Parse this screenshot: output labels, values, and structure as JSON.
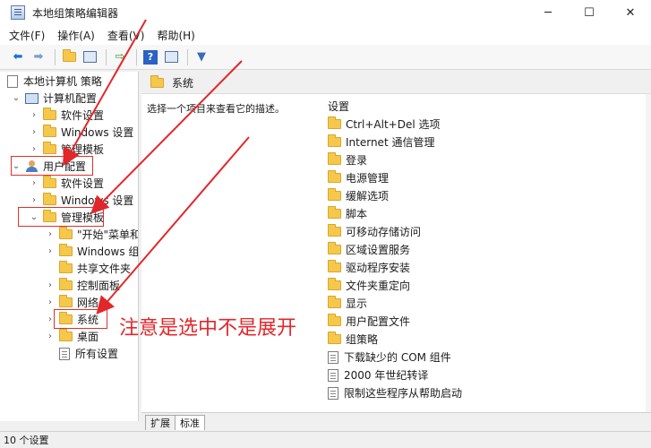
{
  "window": {
    "title": "本地组策略编辑器",
    "minimize_glyph": "─",
    "maximize_glyph": "☐",
    "close_glyph": "✕"
  },
  "menu": [
    "文件(F)",
    "操作(A)",
    "查看(V)",
    "帮助(H)"
  ],
  "toolbar": {
    "buttons": [
      "back-arrow-icon",
      "forward-arrow-icon",
      "up-folder-icon",
      "show-hide-tree-icon",
      "export-list-icon",
      "help-icon",
      "properties-icon",
      "filter-icon"
    ]
  },
  "tree": [
    {
      "label": "本地计算机 策略",
      "icon": "policy-icon",
      "expander": ""
    },
    {
      "label": "计算机配置",
      "icon": "pc-icon",
      "expander": "⌄"
    },
    {
      "label": "软件设置",
      "icon": "folder-icon",
      "expander": "›"
    },
    {
      "label": "Windows 设置",
      "icon": "folder-icon",
      "expander": "›"
    },
    {
      "label": "管理模板",
      "icon": "folder-icon",
      "expander": "›"
    },
    {
      "label": "用户配置",
      "icon": "user-icon",
      "expander": "⌄"
    },
    {
      "label": "软件设置",
      "icon": "folder-icon",
      "expander": "›"
    },
    {
      "label": "Windows 设置",
      "icon": "folder-icon",
      "expander": "›"
    },
    {
      "label": "管理模板",
      "icon": "folder-icon",
      "expander": "⌄"
    },
    {
      "label": "\"开始\"菜单和",
      "icon": "folder-icon",
      "expander": "›"
    },
    {
      "label": "Windows 组",
      "icon": "folder-icon",
      "expander": "›"
    },
    {
      "label": "共享文件夹",
      "icon": "folder-icon",
      "expander": ""
    },
    {
      "label": "控制面板",
      "icon": "folder-icon",
      "expander": "›"
    },
    {
      "label": "网络",
      "icon": "folder-icon",
      "expander": "›"
    },
    {
      "label": "系统",
      "icon": "folder-icon",
      "expander": "›"
    },
    {
      "label": "桌面",
      "icon": "folder-icon",
      "expander": "›"
    },
    {
      "label": "所有设置",
      "icon": "doc-icon",
      "expander": ""
    }
  ],
  "right_pane": {
    "header": "系统",
    "description": "选择一个项目来查看它的描述。",
    "column_header": "设置",
    "items": [
      {
        "label": "Ctrl+Alt+Del 选项",
        "icon": "folder-icon"
      },
      {
        "label": "Internet 通信管理",
        "icon": "folder-icon"
      },
      {
        "label": "登录",
        "icon": "folder-icon"
      },
      {
        "label": "电源管理",
        "icon": "folder-icon"
      },
      {
        "label": "缓解选项",
        "icon": "folder-icon"
      },
      {
        "label": "脚本",
        "icon": "folder-icon"
      },
      {
        "label": "可移动存储访问",
        "icon": "folder-icon"
      },
      {
        "label": "区域设置服务",
        "icon": "folder-icon"
      },
      {
        "label": "驱动程序安装",
        "icon": "folder-icon"
      },
      {
        "label": "文件夹重定向",
        "icon": "folder-icon"
      },
      {
        "label": "显示",
        "icon": "folder-icon"
      },
      {
        "label": "用户配置文件",
        "icon": "folder-icon"
      },
      {
        "label": "组策略",
        "icon": "folder-icon"
      },
      {
        "label": "下载缺少的 COM 组件",
        "icon": "doc-icon"
      },
      {
        "label": "2000 年世纪转译",
        "icon": "doc-icon"
      },
      {
        "label": "限制这些程序从帮助启动",
        "icon": "doc-icon"
      }
    ]
  },
  "tabs": [
    "扩展",
    "标准"
  ],
  "status": "10 个设置",
  "annotation": "注意是选中不是展开",
  "colors": {
    "annotation": "#e2272a",
    "folder": "#f5c84c"
  }
}
